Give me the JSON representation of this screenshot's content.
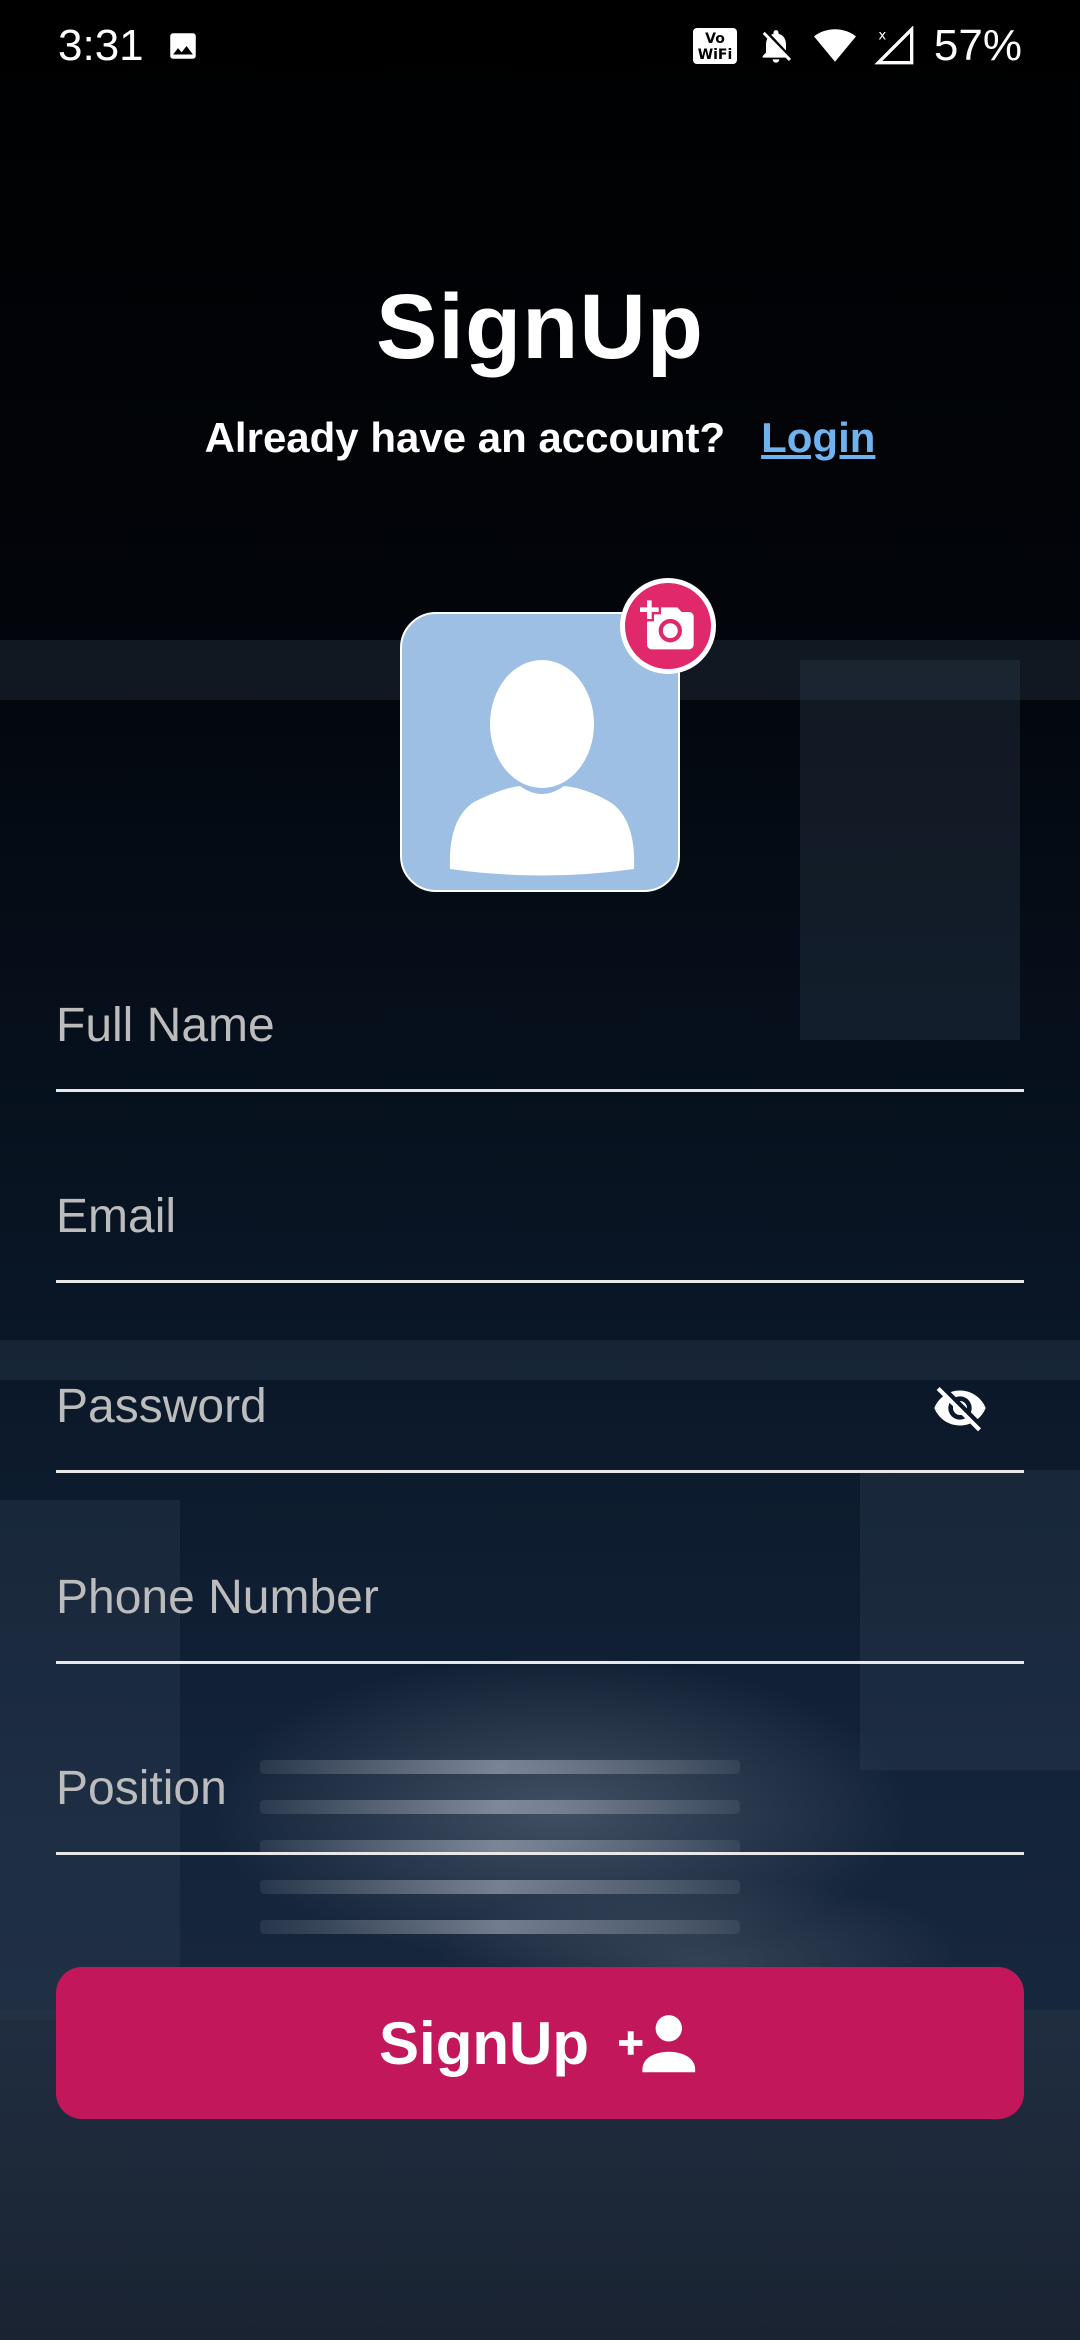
{
  "status_bar": {
    "time": "3:31",
    "battery": "57%",
    "icons": [
      "image-icon",
      "vowifi-icon",
      "bell-off-icon",
      "wifi-icon",
      "signal-icon"
    ]
  },
  "header": {
    "title": "SignUp",
    "subtitle": "Already have an account?",
    "login_link": "Login"
  },
  "avatar": {
    "icon": "person-icon",
    "action_icon": "add-camera-icon",
    "accent_color": "#e0286a"
  },
  "form": {
    "fields": [
      {
        "name": "full-name",
        "placeholder": "Full Name",
        "value": ""
      },
      {
        "name": "email",
        "placeholder": "Email",
        "value": ""
      },
      {
        "name": "password",
        "placeholder": "Password",
        "value": ""
      },
      {
        "name": "phone-number",
        "placeholder": "Phone Number",
        "value": ""
      },
      {
        "name": "position",
        "placeholder": "Position",
        "value": ""
      }
    ],
    "password_toggle_icon": "eye-off-icon"
  },
  "submit": {
    "label": "SignUp",
    "icon": "person-add-icon",
    "color": "#c2185b"
  }
}
